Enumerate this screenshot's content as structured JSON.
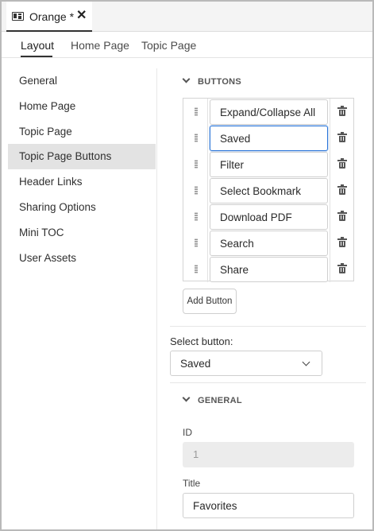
{
  "document_tab": {
    "title": "Orange *",
    "close": "✕",
    "icon": "document-layout-icon"
  },
  "subtabs": [
    "Layout",
    "Home Page",
    "Topic Page"
  ],
  "sidebar": {
    "items": [
      "General",
      "Home Page",
      "Topic Page",
      "Topic Page Buttons",
      "Header Links",
      "Sharing Options",
      "Mini TOC",
      "User Assets"
    ],
    "selected": "Topic Page Buttons"
  },
  "buttons_section": {
    "heading": "BUTTONS",
    "rows": [
      {
        "label": "Expand/Collapse All"
      },
      {
        "label": "Saved",
        "focused": true
      },
      {
        "label": "Filter"
      },
      {
        "label": "Select Bookmark"
      },
      {
        "label": "Download PDF"
      },
      {
        "label": "Search"
      },
      {
        "label": "Share"
      }
    ],
    "add_label": "Add Button"
  },
  "select_button": {
    "label": "Select button:",
    "value": "Saved"
  },
  "general_section": {
    "heading": "GENERAL",
    "id_label": "ID",
    "id_value": "1",
    "title_label": "Title",
    "title_value": "Favorites"
  },
  "colors": {
    "focus": "#2b75d8",
    "selected_bg": "#e3e3e3"
  }
}
